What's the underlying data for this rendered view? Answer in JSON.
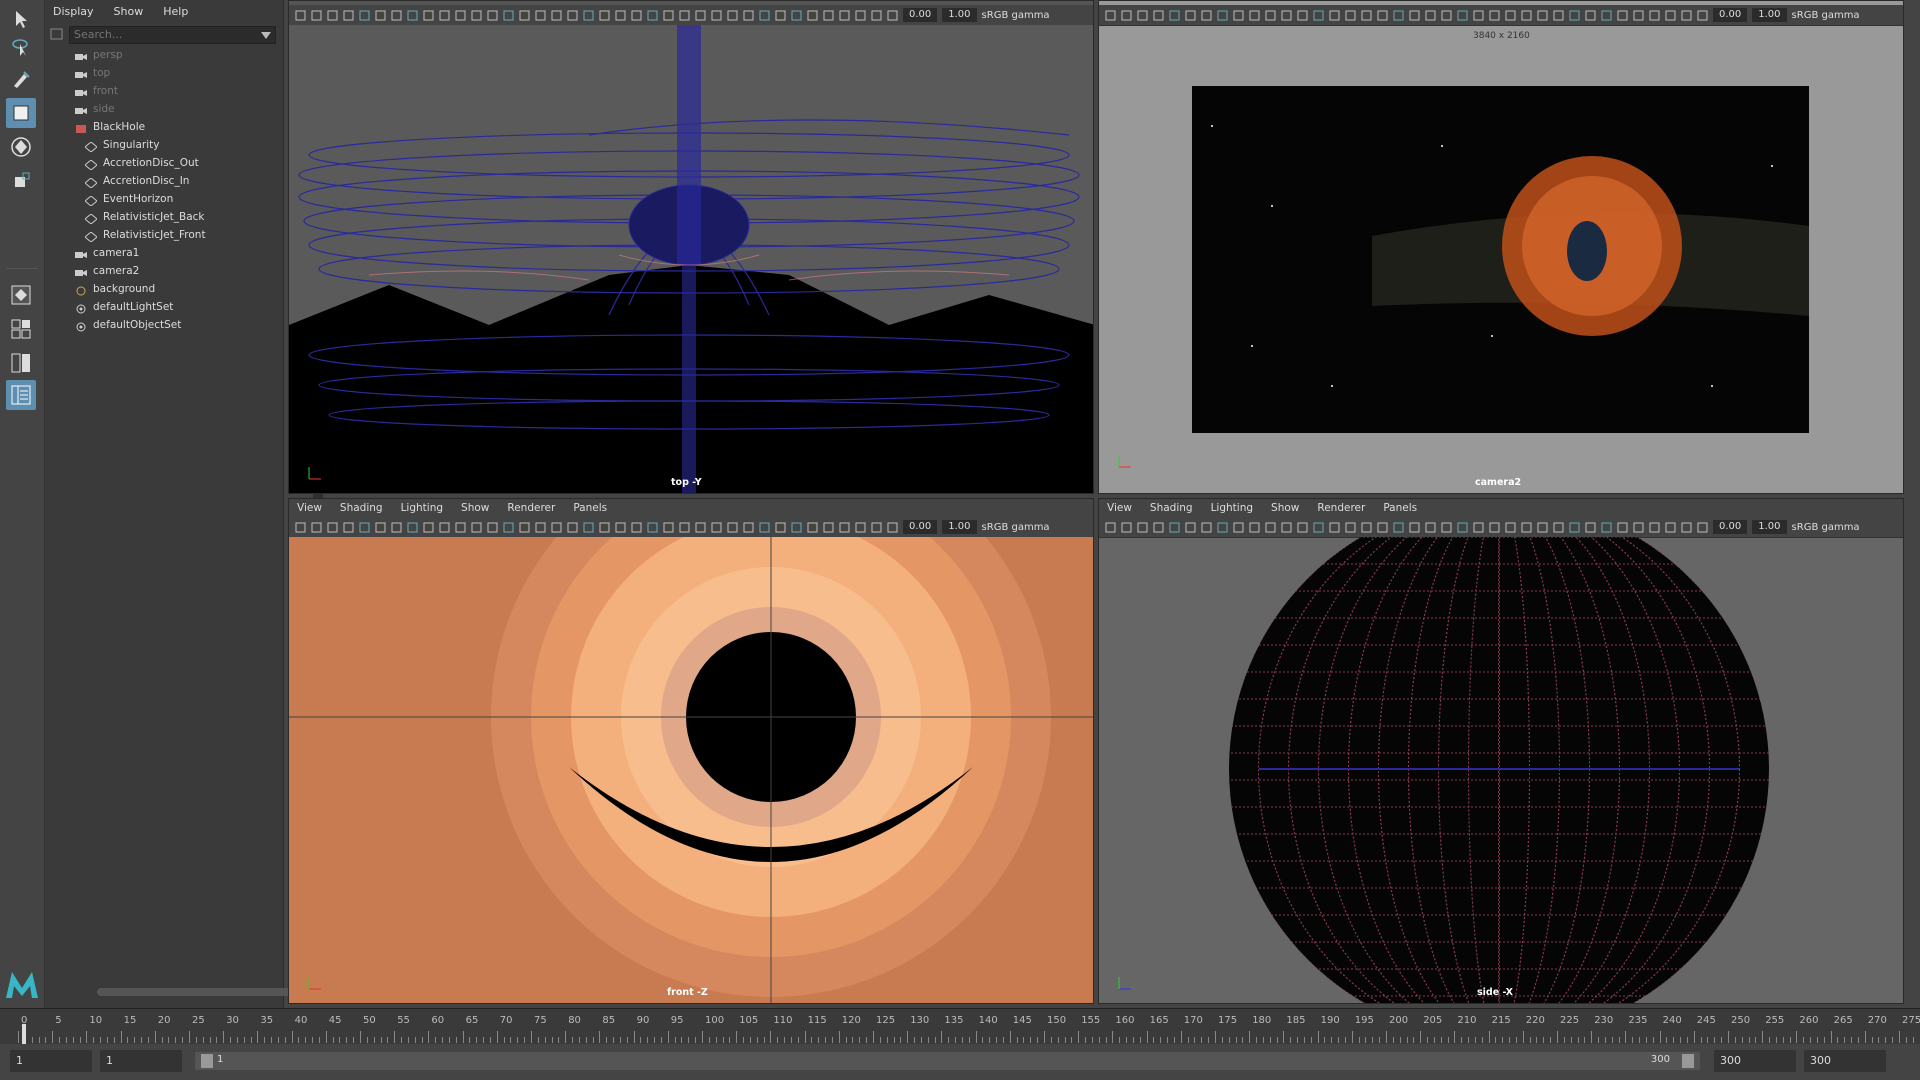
{
  "outliner": {
    "menu": [
      "Display",
      "Show",
      "Help"
    ],
    "search_placeholder": "Search...",
    "items": [
      {
        "label": "persp",
        "type": "camera",
        "dim": true
      },
      {
        "label": "top",
        "type": "camera",
        "dim": true
      },
      {
        "label": "front",
        "type": "camera",
        "dim": true
      },
      {
        "label": "side",
        "type": "camera",
        "dim": true
      },
      {
        "label": "BlackHole",
        "type": "group"
      },
      {
        "label": "Singularity",
        "type": "mesh"
      },
      {
        "label": "AccretionDisc_Out",
        "type": "mesh"
      },
      {
        "label": "AccretionDisc_In",
        "type": "mesh"
      },
      {
        "label": "EventHorizon",
        "type": "mesh"
      },
      {
        "label": "RelativisticJet_Back",
        "type": "mesh"
      },
      {
        "label": "RelativisticJet_Front",
        "type": "mesh"
      },
      {
        "label": "camera1",
        "type": "camera"
      },
      {
        "label": "camera2",
        "type": "camera"
      },
      {
        "label": "background",
        "type": "light"
      },
      {
        "label": "defaultLightSet",
        "type": "set"
      },
      {
        "label": "defaultObjectSet",
        "type": "set"
      }
    ]
  },
  "viewport_menu": [
    "View",
    "Shading",
    "Lighting",
    "Show",
    "Renderer",
    "Panels"
  ],
  "toolbar": {
    "exposure": "0.00",
    "gamma_val": "1.00",
    "gamma_label": "sRGB gamma"
  },
  "panels": {
    "top_left": {
      "label": "top -Y"
    },
    "top_right": {
      "label": "camera2",
      "resolution": "3840 x 2160"
    },
    "bottom_left": {
      "label": "front -Z"
    },
    "bottom_right": {
      "label": "side -X"
    }
  },
  "timeline": {
    "ticks": [
      "0",
      "5",
      "10",
      "15",
      "20",
      "25",
      "30",
      "35",
      "40",
      "45",
      "50",
      "55",
      "60",
      "65",
      "70",
      "75",
      "80",
      "85",
      "90",
      "95",
      "100",
      "105",
      "110",
      "115",
      "120",
      "125",
      "130",
      "135",
      "140",
      "145",
      "150",
      "155",
      "160",
      "165",
      "170",
      "175",
      "180",
      "185",
      "190",
      "195",
      "200",
      "205",
      "210",
      "215",
      "220",
      "225",
      "230",
      "235",
      "240",
      "245",
      "250",
      "255",
      "260",
      "265",
      "270",
      "275"
    ],
    "current_frame": "1"
  },
  "range": {
    "start": "1",
    "start2": "1",
    "slider_start": "1",
    "slider_end": "300",
    "end": "300",
    "end2": "300"
  },
  "colors": {
    "accent": "#5e8fb0",
    "wire": "#2a2a9a",
    "orange": "#f0a060"
  }
}
